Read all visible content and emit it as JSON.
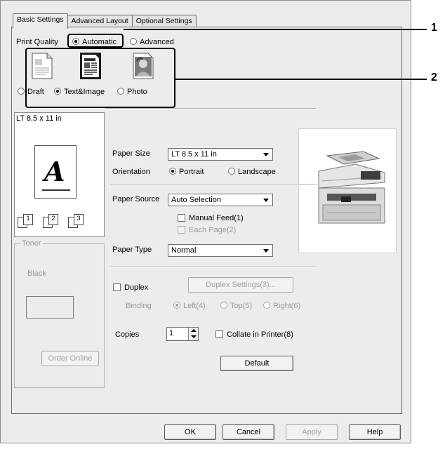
{
  "tabs": [
    {
      "label": "Basic Settings",
      "active": true
    },
    {
      "label": "Advanced Layout",
      "active": false
    },
    {
      "label": "Optional Settings",
      "active": false
    }
  ],
  "print_quality": {
    "label": "Print Quality",
    "automatic": "Automatic",
    "advanced": "Advanced",
    "selected": "Automatic",
    "modes": [
      {
        "label": "Draft",
        "icon": "draft-document-icon"
      },
      {
        "label": "Text&Image",
        "icon": "text-image-document-icon"
      },
      {
        "label": "Photo",
        "icon": "photo-document-icon"
      }
    ],
    "selected_mode": "Text&Image"
  },
  "preview": {
    "paper_label": "LT 8.5 x 11 in",
    "glyph": "A",
    "copy_marks": [
      "1",
      "2",
      "3"
    ]
  },
  "toner": {
    "legend": "Toner",
    "black_label": "Black",
    "order_online": "Order Online"
  },
  "form": {
    "paper_size_label": "Paper Size",
    "paper_size_value": "LT 8.5 x 11 in",
    "orientation_label": "Orientation",
    "portrait": "Portrait",
    "landscape": "Landscape",
    "orientation_selected": "Portrait",
    "paper_source_label": "Paper Source",
    "paper_source_value": "Auto Selection",
    "manual_feed": "Manual Feed(1)",
    "each_page": "Each Page(2)",
    "paper_type_label": "Paper Type",
    "paper_type_value": "Normal",
    "duplex": "Duplex",
    "duplex_settings": "Duplex Settings(3)...",
    "binding_label": "Binding",
    "binding_left": "Left(4)",
    "binding_top": "Top(5)",
    "binding_right": "Right(6)",
    "binding_selected": "Left(4)",
    "copies_label": "Copies",
    "copies_value": "1",
    "collate": "Collate in Printer(8)",
    "default": "Default"
  },
  "footer": {
    "ok": "OK",
    "cancel": "Cancel",
    "apply": "Apply",
    "help": "Help"
  },
  "callouts": [
    "1",
    "2"
  ],
  "printer_image": "multifunction-printer-icon"
}
